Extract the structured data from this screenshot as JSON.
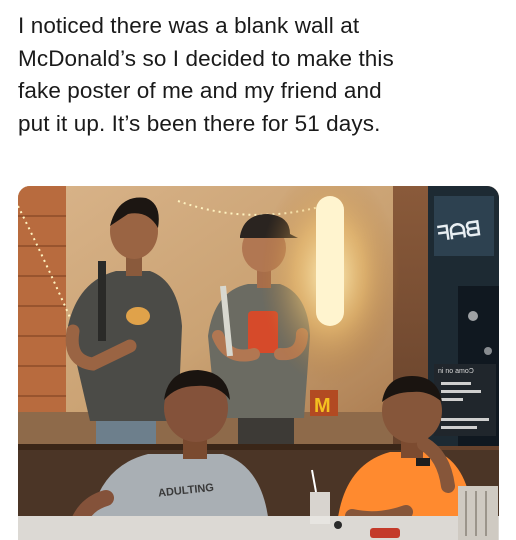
{
  "caption": {
    "lines": [
      "I noticed there was a blank wall at",
      "McDonald’s so I decided to make this",
      "fake poster of me and my friend and",
      "put it up. It’s been there for 51 days."
    ]
  },
  "photo": {
    "shirt_text": "ADULTING",
    "sign_text": "ni no amoƆ",
    "logo_letter": "M"
  }
}
